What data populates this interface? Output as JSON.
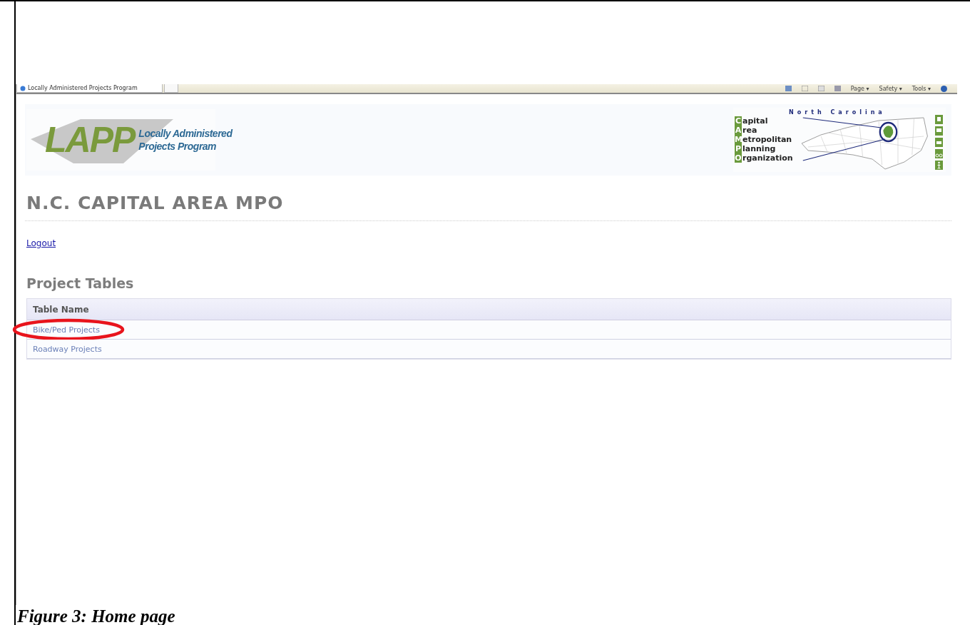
{
  "browser": {
    "tab_title": "Locally Administered Projects Program",
    "toolbar_menus": [
      "Page ▾",
      "Safety ▾",
      "Tools ▾"
    ]
  },
  "header": {
    "lapp_logo": {
      "mark": "LAPP",
      "lines": [
        "Locally Administered",
        "Projects Program"
      ]
    },
    "campo_logo": {
      "region": "North Carolina",
      "words": [
        "Capital",
        "Area",
        "Metropolitan",
        "Planning",
        "Organization"
      ]
    }
  },
  "page_title": "N.C. CAPITAL AREA MPO",
  "logout_link": "Logout",
  "section_title": "Project Tables",
  "table": {
    "columns": [
      "Table Name"
    ],
    "rows": [
      {
        "name": "Bike/Ped Projects",
        "highlighted": true
      },
      {
        "name": "Roadway Projects",
        "highlighted": false
      }
    ]
  },
  "caption": "Figure 3: Home page"
}
